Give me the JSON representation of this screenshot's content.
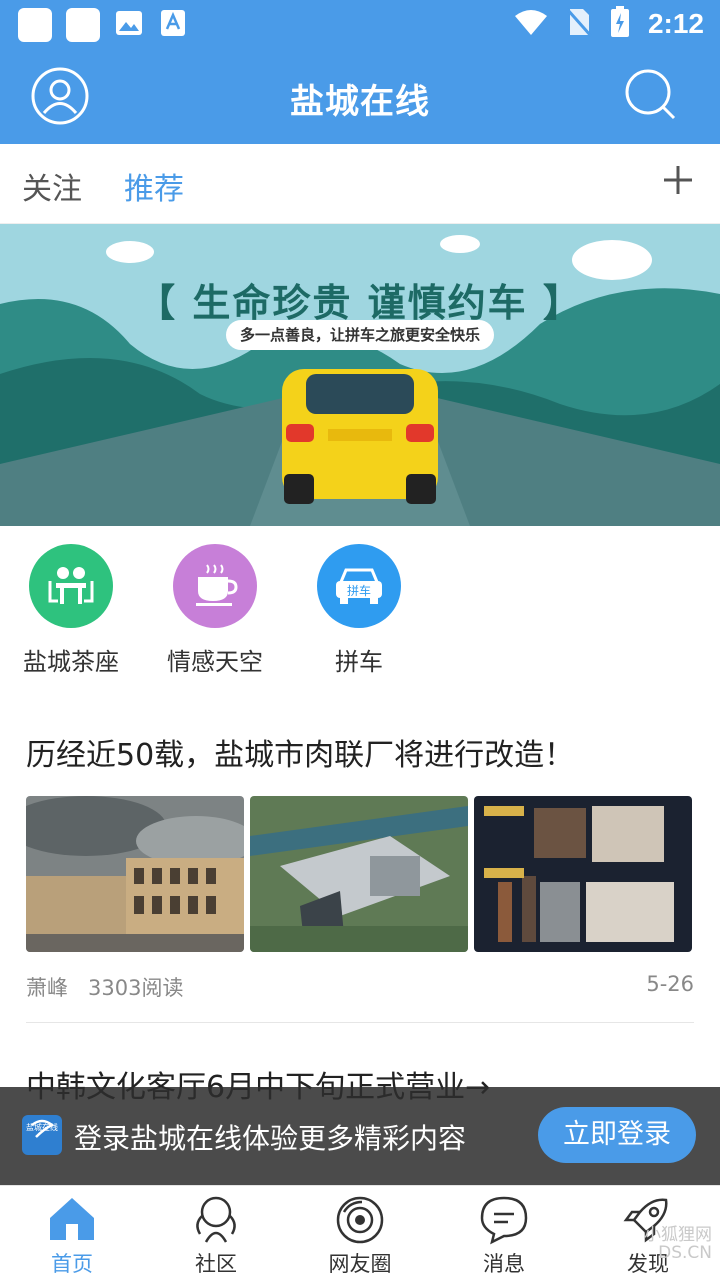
{
  "status_bar": {
    "time": "2:12"
  },
  "header": {
    "title": "盐城在线"
  },
  "tabs": [
    {
      "label": "关注"
    },
    {
      "label": "推荐"
    }
  ],
  "banner": {
    "title": "【 生命珍贵 谨慎约车 】",
    "subtitle": "多一点善良，让拼车之旅更安全快乐"
  },
  "quick_links": [
    {
      "label": "盐城茶座",
      "color": "#2ec27e"
    },
    {
      "label": "情感天空",
      "color": "#c77fd8"
    },
    {
      "label": "拼车",
      "color": "#2f9cf0",
      "icon_text": "拼车"
    }
  ],
  "articles": [
    {
      "title": "历经近50载，盐城市肉联厂将进行改造！",
      "author": "萧峰",
      "reads": "3303阅读",
      "date": "5-26"
    },
    {
      "title": "中韩文化客厅6月中下旬正式营业→"
    }
  ],
  "login_bar": {
    "logo_text": "盐城在线",
    "text": "登录盐城在线体验更多精彩内容",
    "button": "立即登录"
  },
  "bottom_nav": [
    {
      "label": "首页"
    },
    {
      "label": "社区"
    },
    {
      "label": "网友圈"
    },
    {
      "label": "消息"
    },
    {
      "label": "发现"
    }
  ],
  "watermark": {
    "line1": "小狐狸网",
    "line2": "DS.CN"
  },
  "colors": {
    "primary": "#4a9be8",
    "text": "#222222"
  }
}
